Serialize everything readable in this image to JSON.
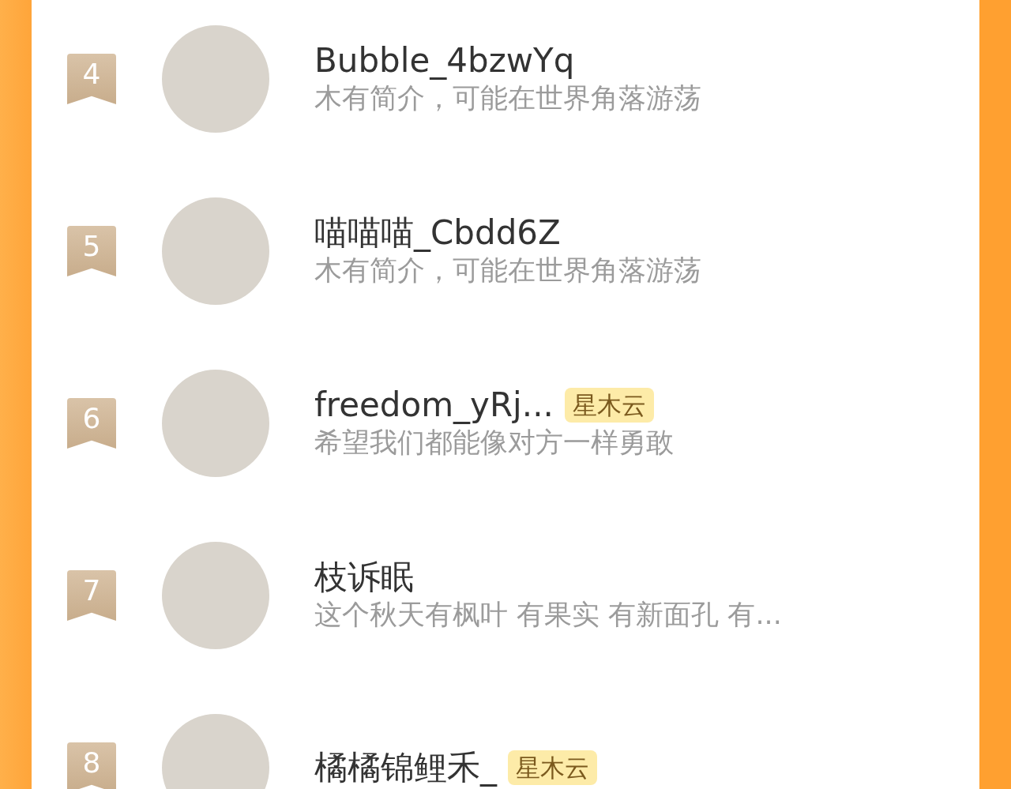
{
  "users": [
    {
      "rank": "4",
      "name": "Bubble_4bzwYq",
      "bio": "木有简介，可能在世界角落游荡"
    },
    {
      "rank": "5",
      "name": "喵喵喵_Cbdd6Z",
      "bio": "木有简介，可能在世界角落游荡"
    },
    {
      "rank": "6",
      "name": "freedom_yRj...",
      "tag": "星木云",
      "bio": "希望我们都能像对方一样勇敢"
    },
    {
      "rank": "7",
      "name": "枝诉眠",
      "bio": "这个秋天有枫叶 有果实 有新面孔 有..."
    },
    {
      "rank": "8",
      "name": "橘橘锦鲤禾_",
      "tag": "星木云"
    }
  ]
}
